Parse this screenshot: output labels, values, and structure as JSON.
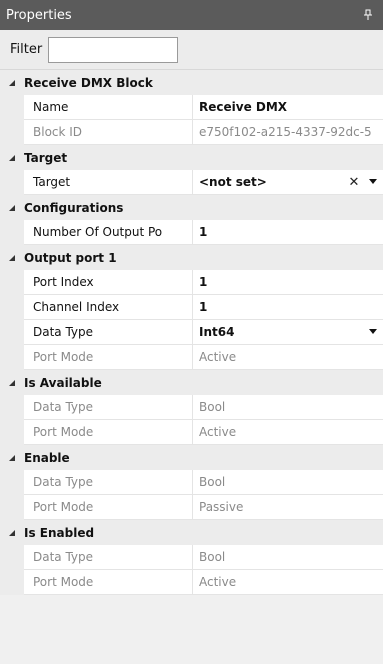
{
  "panel": {
    "title": "Properties"
  },
  "filter": {
    "label": "Filter",
    "value": ""
  },
  "sections": {
    "receive": {
      "title": "Receive DMX Block",
      "name_label": "Name",
      "name_value": "Receive DMX",
      "blockid_label": "Block ID",
      "blockid_value": "e750f102-a215-4337-92dc-5"
    },
    "target": {
      "title": "Target",
      "target_label": "Target",
      "target_value": "<not set>"
    },
    "configurations": {
      "title": "Configurations",
      "outputs_label": "Number Of Output Po",
      "outputs_value": "1"
    },
    "output1": {
      "title": "Output port 1",
      "portindex_label": "Port Index",
      "portindex_value": "1",
      "channelindex_label": "Channel Index",
      "channelindex_value": "1",
      "datatype_label": "Data Type",
      "datatype_value": "Int64",
      "portmode_label": "Port Mode",
      "portmode_value": "Active"
    },
    "isavailable": {
      "title": "Is Available",
      "datatype_label": "Data Type",
      "datatype_value": "Bool",
      "portmode_label": "Port Mode",
      "portmode_value": "Active"
    },
    "enable": {
      "title": "Enable",
      "datatype_label": "Data Type",
      "datatype_value": "Bool",
      "portmode_label": "Port Mode",
      "portmode_value": "Passive"
    },
    "isenabled": {
      "title": "Is Enabled",
      "datatype_label": "Data Type",
      "datatype_value": "Bool",
      "portmode_label": "Port Mode",
      "portmode_value": "Active"
    }
  },
  "icons": {
    "pin": "pin-icon",
    "collapse": "collapse-triangle-icon",
    "clear": "clear-icon",
    "dropdown": "dropdown-arrow-icon"
  },
  "colors": {
    "titlebar": "#5b5b5b",
    "readonly_text": "#8a8a8a"
  }
}
